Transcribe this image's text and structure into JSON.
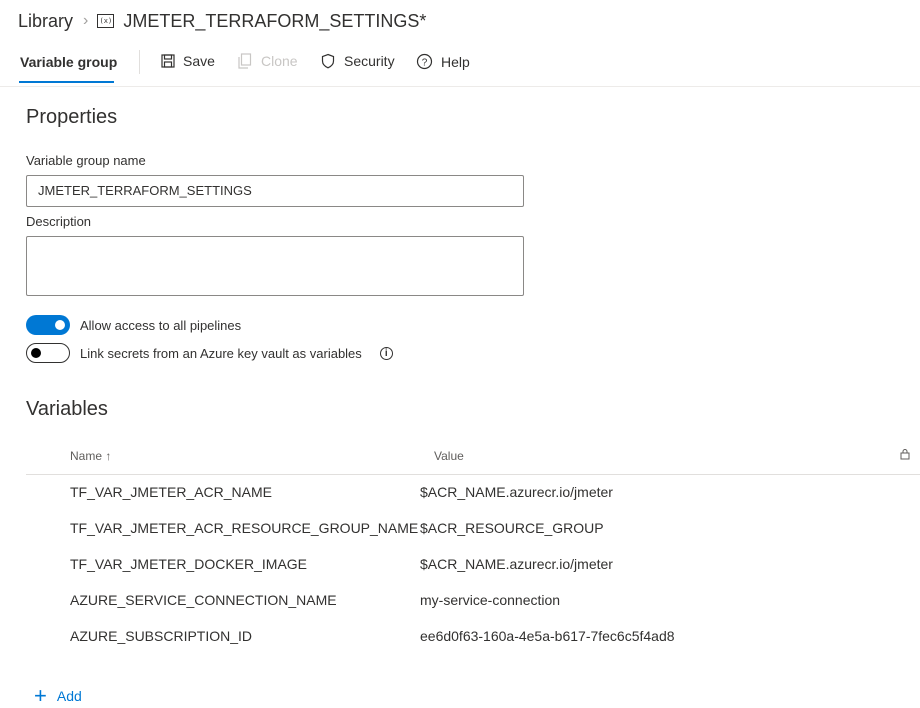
{
  "breadcrumb": {
    "root": "Library",
    "title": "JMETER_TERRAFORM_SETTINGS*"
  },
  "toolbar": {
    "tab_label": "Variable group",
    "save_label": "Save",
    "clone_label": "Clone",
    "security_label": "Security",
    "help_label": "Help"
  },
  "properties": {
    "title": "Properties",
    "name_label": "Variable group name",
    "name_value": "JMETER_TERRAFORM_SETTINGS",
    "description_label": "Description",
    "description_value": "",
    "allow_access_label": "Allow access to all pipelines",
    "allow_access_on": true,
    "link_secrets_label": "Link secrets from an Azure key vault as variables",
    "link_secrets_on": false
  },
  "variables": {
    "title": "Variables",
    "columns": {
      "name": "Name",
      "value": "Value"
    },
    "rows": [
      {
        "name": "TF_VAR_JMETER_ACR_NAME",
        "value": "$ACR_NAME.azurecr.io/jmeter"
      },
      {
        "name": "TF_VAR_JMETER_ACR_RESOURCE_GROUP_NAME",
        "value": "$ACR_RESOURCE_GROUP"
      },
      {
        "name": "TF_VAR_JMETER_DOCKER_IMAGE",
        "value": "$ACR_NAME.azurecr.io/jmeter"
      },
      {
        "name": "AZURE_SERVICE_CONNECTION_NAME",
        "value": "my-service-connection"
      },
      {
        "name": "AZURE_SUBSCRIPTION_ID",
        "value": "ee6d0f63-160a-4e5a-b617-7fec6c5f4ad8"
      }
    ],
    "add_label": "Add"
  },
  "colors": {
    "accent": "#0078d4",
    "text": "#323130",
    "muted": "#605e5c",
    "disabled": "#c8c6c4"
  }
}
